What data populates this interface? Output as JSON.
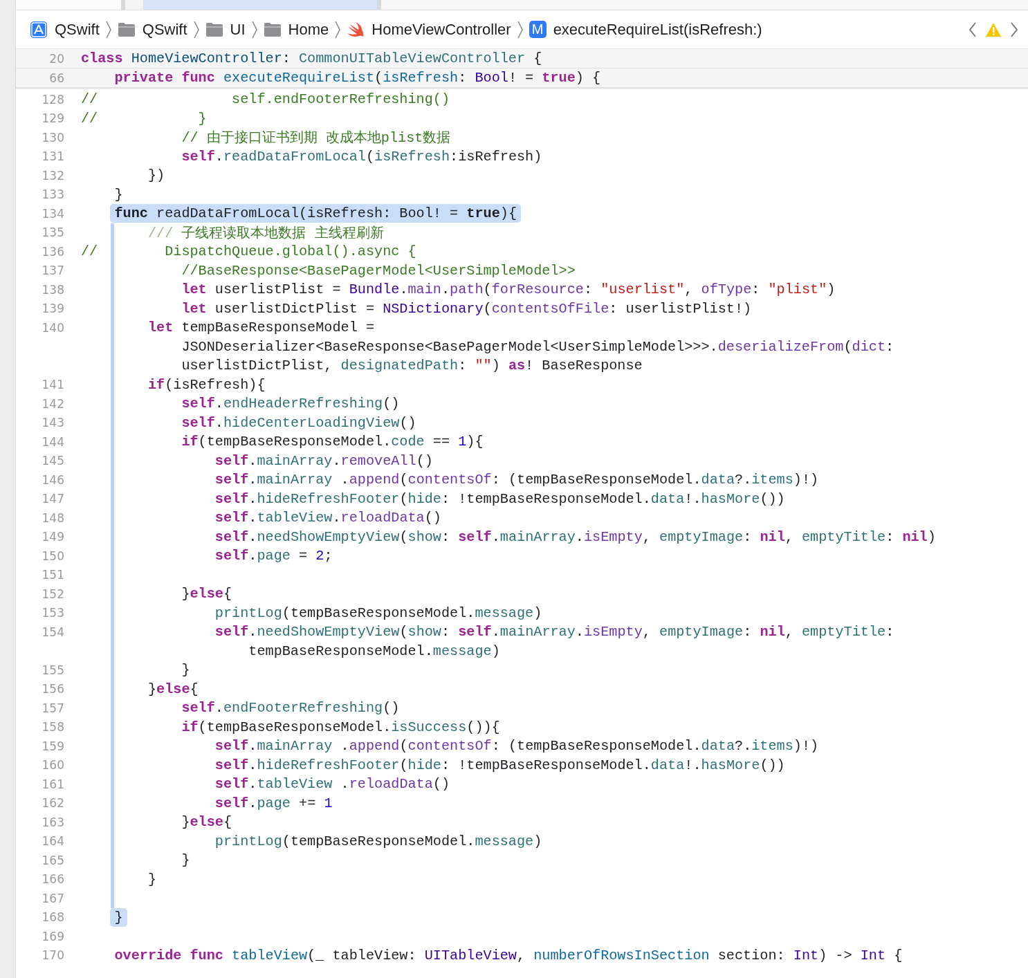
{
  "breadcrumb": {
    "items": [
      {
        "label": "QSwift",
        "kind": "project"
      },
      {
        "label": "QSwift",
        "kind": "folder"
      },
      {
        "label": "UI",
        "kind": "folder"
      },
      {
        "label": "Home",
        "kind": "folder"
      },
      {
        "label": "HomeViewController",
        "kind": "swift"
      },
      {
        "label": "executeRequireList(isRefresh:)",
        "kind": "method",
        "badge": "M"
      }
    ]
  },
  "sticky_header": [
    {
      "number": "20",
      "segments": [
        {
          "tokens": [
            {
              "kind": "keyword",
              "text": "class "
            },
            {
              "kind": "typedecl",
              "text": "HomeViewController"
            },
            {
              "kind": "plain",
              "text": ": "
            },
            {
              "kind": "project",
              "text": "CommonUITableViewController"
            },
            {
              "kind": "plain",
              "text": " {"
            }
          ]
        }
      ]
    },
    {
      "number": "66",
      "segments": [
        {
          "tokens": [
            {
              "kind": "keyword",
              "text": "    private func "
            },
            {
              "kind": "funcdecl",
              "text": "executeRequireList"
            },
            {
              "kind": "plain",
              "text": "("
            },
            {
              "kind": "funcdecl",
              "text": "isRefresh"
            },
            {
              "kind": "plain",
              "text": ": "
            },
            {
              "kind": "systype",
              "text": "Bool"
            },
            {
              "kind": "plain",
              "text": "! = "
            },
            {
              "kind": "keyword",
              "text": "true"
            },
            {
              "kind": "plain",
              "text": ") {"
            }
          ]
        }
      ]
    }
  ],
  "lines": [
    {
      "number": "128",
      "kind": "plain",
      "segments": [
        {
          "tokens": [
            {
              "kind": "comment",
              "text": "//                self.endFooterRefreshing()"
            }
          ]
        }
      ]
    },
    {
      "number": "129",
      "kind": "plain",
      "segments": [
        {
          "tokens": [
            {
              "kind": "comment",
              "text": "//            }"
            }
          ]
        }
      ]
    },
    {
      "number": "130",
      "kind": "plain",
      "segments": [
        {
          "tokens": [
            {
              "kind": "comment",
              "text": "            // 由于接口证书到期 改成本地plist数据"
            }
          ]
        }
      ]
    },
    {
      "number": "131",
      "kind": "plain",
      "segments": [
        {
          "tokens": [
            {
              "kind": "keyword",
              "text": "            self"
            },
            {
              "kind": "plain",
              "text": "."
            },
            {
              "kind": "project",
              "text": "readDataFromLocal"
            },
            {
              "kind": "plain",
              "text": "("
            },
            {
              "kind": "project",
              "text": "isRefresh"
            },
            {
              "kind": "plain",
              "text": ":isRefresh)"
            }
          ]
        }
      ]
    },
    {
      "number": "132",
      "kind": "plain",
      "segments": [
        {
          "tokens": [
            {
              "kind": "plain",
              "text": "        })"
            }
          ]
        }
      ]
    },
    {
      "number": "133",
      "kind": "plain",
      "segments": [
        {
          "tokens": [
            {
              "kind": "plain",
              "text": "    }"
            }
          ]
        }
      ]
    },
    {
      "number": "134",
      "kind": "start",
      "segments": [
        {
          "tokens": [
            {
              "kind": "bold",
              "text": "    func "
            },
            {
              "kind": "plain",
              "text": "readDataFromLocal(isRefresh: Bool! = "
            },
            {
              "kind": "bold",
              "text": "true"
            },
            {
              "kind": "plain",
              "text": "){"
            }
          ]
        }
      ]
    },
    {
      "number": "135",
      "kind": "inside",
      "segments": [
        {
          "tokens": [
            {
              "kind": "doc",
              "text": "        /// "
            },
            {
              "kind": "comment",
              "text": "子线程读取本地数据 主线程刷新"
            }
          ]
        }
      ]
    },
    {
      "number": "136",
      "kind": "inside",
      "segments": [
        {
          "tokens": [
            {
              "kind": "comment",
              "text": "//        DispatchQueue.global().async {"
            }
          ]
        }
      ]
    },
    {
      "number": "137",
      "kind": "inside",
      "segments": [
        {
          "tokens": [
            {
              "kind": "comment",
              "text": "            //BaseResponse<BasePagerModel<UserSimpleModel>>"
            }
          ]
        }
      ]
    },
    {
      "number": "138",
      "kind": "inside",
      "segments": [
        {
          "tokens": [
            {
              "kind": "keyword",
              "text": "            let "
            },
            {
              "kind": "plain",
              "text": "userlistPlist = "
            },
            {
              "kind": "systype",
              "text": "Bundle"
            },
            {
              "kind": "plain",
              "text": "."
            },
            {
              "kind": "sysmember",
              "text": "main"
            },
            {
              "kind": "plain",
              "text": "."
            },
            {
              "kind": "sysmember",
              "text": "path"
            },
            {
              "kind": "plain",
              "text": "("
            },
            {
              "kind": "sysmember",
              "text": "forResource"
            },
            {
              "kind": "plain",
              "text": ": "
            },
            {
              "kind": "string",
              "text": "\"userlist\""
            },
            {
              "kind": "plain",
              "text": ", "
            },
            {
              "kind": "sysmember",
              "text": "ofType"
            },
            {
              "kind": "plain",
              "text": ": "
            },
            {
              "kind": "string",
              "text": "\"plist\""
            },
            {
              "kind": "plain",
              "text": ")"
            }
          ]
        }
      ]
    },
    {
      "number": "139",
      "kind": "inside",
      "segments": [
        {
          "tokens": [
            {
              "kind": "keyword",
              "text": "            let "
            },
            {
              "kind": "plain",
              "text": "userlistDictPlist = "
            },
            {
              "kind": "systype",
              "text": "NSDictionary"
            },
            {
              "kind": "plain",
              "text": "("
            },
            {
              "kind": "sysmember",
              "text": "contentsOfFile"
            },
            {
              "kind": "plain",
              "text": ": userlistPlist!)"
            }
          ]
        }
      ]
    },
    {
      "number": "140",
      "kind": "inside",
      "segments": [
        {
          "tokens": [
            {
              "kind": "keyword",
              "text": "        let "
            },
            {
              "kind": "plain",
              "text": "tempBaseResponseModel ="
            }
          ]
        },
        {
          "tokens": [
            {
              "kind": "plain",
              "text": "            JSONDeserializer<BaseResponse<BasePagerModel<UserSimpleModel>>>."
            },
            {
              "kind": "sysmember",
              "text": "deserializeFrom"
            },
            {
              "kind": "plain",
              "text": "("
            },
            {
              "kind": "sysmember",
              "text": "dict"
            },
            {
              "kind": "plain",
              "text": ":"
            }
          ]
        },
        {
          "tokens": [
            {
              "kind": "plain",
              "text": "            userlistDictPlist, "
            },
            {
              "kind": "project",
              "text": "designatedPath"
            },
            {
              "kind": "plain",
              "text": ": "
            },
            {
              "kind": "string",
              "text": "\"\""
            },
            {
              "kind": "plain",
              "text": ") "
            },
            {
              "kind": "keyword",
              "text": "as"
            },
            {
              "kind": "plain",
              "text": "! BaseResponse"
            }
          ]
        }
      ]
    },
    {
      "number": "141",
      "kind": "inside",
      "segments": [
        {
          "tokens": [
            {
              "kind": "keyword",
              "text": "        if"
            },
            {
              "kind": "plain",
              "text": "(isRefresh){"
            }
          ]
        }
      ]
    },
    {
      "number": "142",
      "kind": "inside",
      "segments": [
        {
          "tokens": [
            {
              "kind": "keyword",
              "text": "            self"
            },
            {
              "kind": "plain",
              "text": "."
            },
            {
              "kind": "project",
              "text": "endHeaderRefreshing"
            },
            {
              "kind": "plain",
              "text": "()"
            }
          ]
        }
      ]
    },
    {
      "number": "143",
      "kind": "inside",
      "segments": [
        {
          "tokens": [
            {
              "kind": "keyword",
              "text": "            self"
            },
            {
              "kind": "plain",
              "text": "."
            },
            {
              "kind": "project",
              "text": "hideCenterLoadingView"
            },
            {
              "kind": "plain",
              "text": "()"
            }
          ]
        }
      ]
    },
    {
      "number": "144",
      "kind": "inside",
      "segments": [
        {
          "tokens": [
            {
              "kind": "keyword",
              "text": "            if"
            },
            {
              "kind": "plain",
              "text": "(tempBaseResponseModel."
            },
            {
              "kind": "project",
              "text": "code"
            },
            {
              "kind": "plain",
              "text": " == "
            },
            {
              "kind": "number",
              "text": "1"
            },
            {
              "kind": "plain",
              "text": "){"
            }
          ]
        }
      ]
    },
    {
      "number": "145",
      "kind": "inside",
      "segments": [
        {
          "tokens": [
            {
              "kind": "keyword",
              "text": "                self"
            },
            {
              "kind": "plain",
              "text": "."
            },
            {
              "kind": "project",
              "text": "mainArray"
            },
            {
              "kind": "plain",
              "text": "."
            },
            {
              "kind": "sysmember",
              "text": "removeAll"
            },
            {
              "kind": "plain",
              "text": "()"
            }
          ]
        }
      ]
    },
    {
      "number": "146",
      "kind": "inside",
      "segments": [
        {
          "tokens": [
            {
              "kind": "keyword",
              "text": "                self"
            },
            {
              "kind": "plain",
              "text": "."
            },
            {
              "kind": "project",
              "text": "mainArray"
            },
            {
              "kind": "plain",
              "text": " ."
            },
            {
              "kind": "sysmember",
              "text": "append"
            },
            {
              "kind": "plain",
              "text": "("
            },
            {
              "kind": "sysmember",
              "text": "contentsOf"
            },
            {
              "kind": "plain",
              "text": ": (tempBaseResponseModel."
            },
            {
              "kind": "project",
              "text": "data"
            },
            {
              "kind": "plain",
              "text": "?."
            },
            {
              "kind": "project",
              "text": "items"
            },
            {
              "kind": "plain",
              "text": ")!)"
            }
          ]
        }
      ]
    },
    {
      "number": "147",
      "kind": "inside",
      "segments": [
        {
          "tokens": [
            {
              "kind": "keyword",
              "text": "                self"
            },
            {
              "kind": "plain",
              "text": "."
            },
            {
              "kind": "project",
              "text": "hideRefreshFooter"
            },
            {
              "kind": "plain",
              "text": "("
            },
            {
              "kind": "project",
              "text": "hide"
            },
            {
              "kind": "plain",
              "text": ": !tempBaseResponseModel."
            },
            {
              "kind": "project",
              "text": "data"
            },
            {
              "kind": "plain",
              "text": "!."
            },
            {
              "kind": "project",
              "text": "hasMore"
            },
            {
              "kind": "plain",
              "text": "())"
            }
          ]
        }
      ]
    },
    {
      "number": "148",
      "kind": "inside",
      "segments": [
        {
          "tokens": [
            {
              "kind": "keyword",
              "text": "                self"
            },
            {
              "kind": "plain",
              "text": "."
            },
            {
              "kind": "project",
              "text": "tableView"
            },
            {
              "kind": "plain",
              "text": "."
            },
            {
              "kind": "sysmember",
              "text": "reloadData"
            },
            {
              "kind": "plain",
              "text": "()"
            }
          ]
        }
      ]
    },
    {
      "number": "149",
      "kind": "inside",
      "segments": [
        {
          "tokens": [
            {
              "kind": "keyword",
              "text": "                self"
            },
            {
              "kind": "plain",
              "text": "."
            },
            {
              "kind": "project",
              "text": "needShowEmptyView"
            },
            {
              "kind": "plain",
              "text": "("
            },
            {
              "kind": "project",
              "text": "show"
            },
            {
              "kind": "plain",
              "text": ": "
            },
            {
              "kind": "keyword",
              "text": "self"
            },
            {
              "kind": "plain",
              "text": "."
            },
            {
              "kind": "project",
              "text": "mainArray"
            },
            {
              "kind": "plain",
              "text": "."
            },
            {
              "kind": "sysmember",
              "text": "isEmpty"
            },
            {
              "kind": "plain",
              "text": ", "
            },
            {
              "kind": "project",
              "text": "emptyImage"
            },
            {
              "kind": "plain",
              "text": ": "
            },
            {
              "kind": "keyword",
              "text": "nil"
            },
            {
              "kind": "plain",
              "text": ", "
            },
            {
              "kind": "project",
              "text": "emptyTitle"
            },
            {
              "kind": "plain",
              "text": ": "
            },
            {
              "kind": "keyword",
              "text": "nil"
            },
            {
              "kind": "plain",
              "text": ")"
            }
          ]
        }
      ]
    },
    {
      "number": "150",
      "kind": "inside",
      "segments": [
        {
          "tokens": [
            {
              "kind": "keyword",
              "text": "                self"
            },
            {
              "kind": "plain",
              "text": "."
            },
            {
              "kind": "project",
              "text": "page"
            },
            {
              "kind": "plain",
              "text": " = "
            },
            {
              "kind": "number",
              "text": "2"
            },
            {
              "kind": "plain",
              "text": ";"
            }
          ]
        }
      ]
    },
    {
      "number": "151",
      "kind": "inside"
    },
    {
      "number": "152",
      "kind": "inside",
      "segments": [
        {
          "tokens": [
            {
              "kind": "plain",
              "text": "            }"
            },
            {
              "kind": "keyword",
              "text": "else"
            },
            {
              "kind": "plain",
              "text": "{"
            }
          ]
        }
      ]
    },
    {
      "number": "153",
      "kind": "inside",
      "segments": [
        {
          "tokens": [
            {
              "kind": "project",
              "text": "                printLog"
            },
            {
              "kind": "plain",
              "text": "(tempBaseResponseModel."
            },
            {
              "kind": "project",
              "text": "message"
            },
            {
              "kind": "plain",
              "text": ")"
            }
          ]
        }
      ]
    },
    {
      "number": "154",
      "kind": "inside",
      "segments": [
        {
          "tokens": [
            {
              "kind": "keyword",
              "text": "                self"
            },
            {
              "kind": "plain",
              "text": "."
            },
            {
              "kind": "project",
              "text": "needShowEmptyView"
            },
            {
              "kind": "plain",
              "text": "("
            },
            {
              "kind": "project",
              "text": "show"
            },
            {
              "kind": "plain",
              "text": ": "
            },
            {
              "kind": "keyword",
              "text": "self"
            },
            {
              "kind": "plain",
              "text": "."
            },
            {
              "kind": "project",
              "text": "mainArray"
            },
            {
              "kind": "plain",
              "text": "."
            },
            {
              "kind": "sysmember",
              "text": "isEmpty"
            },
            {
              "kind": "plain",
              "text": ", "
            },
            {
              "kind": "project",
              "text": "emptyImage"
            },
            {
              "kind": "plain",
              "text": ": "
            },
            {
              "kind": "keyword",
              "text": "nil"
            },
            {
              "kind": "plain",
              "text": ", "
            },
            {
              "kind": "project",
              "text": "emptyTitle"
            },
            {
              "kind": "plain",
              "text": ":"
            }
          ]
        },
        {
          "tokens": [
            {
              "kind": "plain",
              "text": "                    tempBaseResponseModel."
            },
            {
              "kind": "project",
              "text": "message"
            },
            {
              "kind": "plain",
              "text": ")"
            }
          ]
        }
      ]
    },
    {
      "number": "155",
      "kind": "inside",
      "segments": [
        {
          "tokens": [
            {
              "kind": "plain",
              "text": "            }"
            }
          ]
        }
      ]
    },
    {
      "number": "156",
      "kind": "inside",
      "segments": [
        {
          "tokens": [
            {
              "kind": "plain",
              "text": "        }"
            },
            {
              "kind": "keyword",
              "text": "else"
            },
            {
              "kind": "plain",
              "text": "{"
            }
          ]
        }
      ]
    },
    {
      "number": "157",
      "kind": "inside",
      "segments": [
        {
          "tokens": [
            {
              "kind": "keyword",
              "text": "            self"
            },
            {
              "kind": "plain",
              "text": "."
            },
            {
              "kind": "project",
              "text": "endFooterRefreshing"
            },
            {
              "kind": "plain",
              "text": "()"
            }
          ]
        }
      ]
    },
    {
      "number": "158",
      "kind": "inside",
      "segments": [
        {
          "tokens": [
            {
              "kind": "keyword",
              "text": "            if"
            },
            {
              "kind": "plain",
              "text": "(tempBaseResponseModel."
            },
            {
              "kind": "project",
              "text": "isSuccess"
            },
            {
              "kind": "plain",
              "text": "()){"
            }
          ]
        }
      ]
    },
    {
      "number": "159",
      "kind": "inside",
      "segments": [
        {
          "tokens": [
            {
              "kind": "keyword",
              "text": "                self"
            },
            {
              "kind": "plain",
              "text": "."
            },
            {
              "kind": "project",
              "text": "mainArray"
            },
            {
              "kind": "plain",
              "text": " ."
            },
            {
              "kind": "sysmember",
              "text": "append"
            },
            {
              "kind": "plain",
              "text": "("
            },
            {
              "kind": "sysmember",
              "text": "contentsOf"
            },
            {
              "kind": "plain",
              "text": ": (tempBaseResponseModel."
            },
            {
              "kind": "project",
              "text": "data"
            },
            {
              "kind": "plain",
              "text": "?."
            },
            {
              "kind": "project",
              "text": "items"
            },
            {
              "kind": "plain",
              "text": ")!)"
            }
          ]
        }
      ]
    },
    {
      "number": "160",
      "kind": "inside",
      "segments": [
        {
          "tokens": [
            {
              "kind": "keyword",
              "text": "                self"
            },
            {
              "kind": "plain",
              "text": "."
            },
            {
              "kind": "project",
              "text": "hideRefreshFooter"
            },
            {
              "kind": "plain",
              "text": "("
            },
            {
              "kind": "project",
              "text": "hide"
            },
            {
              "kind": "plain",
              "text": ": !tempBaseResponseModel."
            },
            {
              "kind": "project",
              "text": "data"
            },
            {
              "kind": "plain",
              "text": "!."
            },
            {
              "kind": "project",
              "text": "hasMore"
            },
            {
              "kind": "plain",
              "text": "())"
            }
          ]
        }
      ]
    },
    {
      "number": "161",
      "kind": "inside",
      "segments": [
        {
          "tokens": [
            {
              "kind": "keyword",
              "text": "                self"
            },
            {
              "kind": "plain",
              "text": "."
            },
            {
              "kind": "project",
              "text": "tableView"
            },
            {
              "kind": "plain",
              "text": " ."
            },
            {
              "kind": "sysmember",
              "text": "reloadData"
            },
            {
              "kind": "plain",
              "text": "()"
            }
          ]
        }
      ]
    },
    {
      "number": "162",
      "kind": "inside",
      "segments": [
        {
          "tokens": [
            {
              "kind": "keyword",
              "text": "                self"
            },
            {
              "kind": "plain",
              "text": "."
            },
            {
              "kind": "project",
              "text": "page"
            },
            {
              "kind": "plain",
              "text": " += "
            },
            {
              "kind": "number",
              "text": "1"
            }
          ]
        }
      ]
    },
    {
      "number": "163",
      "kind": "inside",
      "segments": [
        {
          "tokens": [
            {
              "kind": "plain",
              "text": "            }"
            },
            {
              "kind": "keyword",
              "text": "else"
            },
            {
              "kind": "plain",
              "text": "{"
            }
          ]
        }
      ]
    },
    {
      "number": "164",
      "kind": "inside",
      "segments": [
        {
          "tokens": [
            {
              "kind": "project",
              "text": "                printLog"
            },
            {
              "kind": "plain",
              "text": "(tempBaseResponseModel."
            },
            {
              "kind": "project",
              "text": "message"
            },
            {
              "kind": "plain",
              "text": ")"
            }
          ]
        }
      ]
    },
    {
      "number": "165",
      "kind": "inside",
      "segments": [
        {
          "tokens": [
            {
              "kind": "plain",
              "text": "            }"
            }
          ]
        }
      ]
    },
    {
      "number": "166",
      "kind": "inside",
      "segments": [
        {
          "tokens": [
            {
              "kind": "plain",
              "text": "        }"
            }
          ]
        }
      ]
    },
    {
      "number": "167",
      "kind": "inside"
    },
    {
      "number": "168",
      "kind": "end",
      "segments": [
        {
          "tokens": [
            {
              "kind": "plain",
              "text": "    }"
            }
          ]
        }
      ]
    },
    {
      "number": "169",
      "kind": "plain"
    },
    {
      "number": "170",
      "kind": "plain",
      "segments": [
        {
          "tokens": [
            {
              "kind": "keyword",
              "text": "    override func "
            },
            {
              "kind": "funcdecl",
              "text": "tableView"
            },
            {
              "kind": "plain",
              "text": "(_ tableView: "
            },
            {
              "kind": "systype",
              "text": "UITableView"
            },
            {
              "kind": "plain",
              "text": ", "
            },
            {
              "kind": "funcdecl",
              "text": "numberOfRowsInSection"
            },
            {
              "kind": "plain",
              "text": " section: "
            },
            {
              "kind": "systype",
              "text": "Int"
            },
            {
              "kind": "plain",
              "text": ") -> "
            },
            {
              "kind": "systype",
              "text": "Int"
            },
            {
              "kind": "plain",
              "text": " {"
            }
          ]
        }
      ]
    }
  ]
}
